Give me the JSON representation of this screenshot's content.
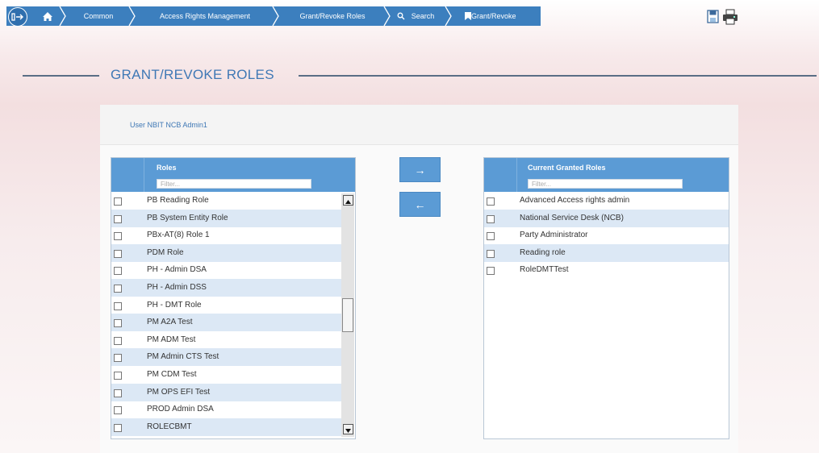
{
  "breadcrumb": {
    "items": [
      "Common",
      "Access Rights Management",
      "Grant/Revoke Roles",
      "Search",
      "Grant/Revoke"
    ]
  },
  "page": {
    "title": "GRANT/REVOKE ROLES",
    "user_label": "User NBIT NCB Admin1"
  },
  "available_roles": {
    "header": "Roles",
    "filter_placeholder": "Filter...",
    "items": [
      "PB Reading Role",
      "PB System Entity Role",
      "PBx-AT(8) Role 1",
      "PDM Role",
      "PH - Admin DSA",
      "PH - Admin DSS",
      "PH - DMT Role",
      "PM A2A Test",
      "PM ADM Test",
      "PM Admin CTS Test",
      "PM CDM Test",
      "PM OPS EFI Test",
      "PROD Admin DSA",
      "ROLECBMT"
    ]
  },
  "granted_roles": {
    "header": "Current Granted Roles",
    "filter_placeholder": "Filter...",
    "items": [
      "Advanced Access rights admin",
      "National Service Desk (NCB)",
      "Party Administrator",
      "Reading role",
      "RoleDMTTest"
    ]
  },
  "actions": {
    "grant_glyph": "→",
    "revoke_glyph": "←"
  },
  "colors": {
    "accent": "#3c7fbe",
    "header_blue": "#5b9bd5",
    "row_alt": "#dce8f5"
  }
}
